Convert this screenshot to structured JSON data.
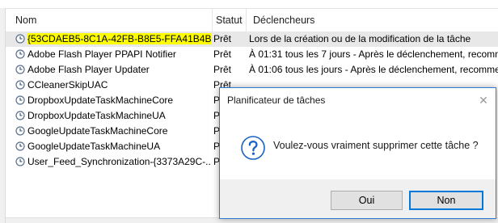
{
  "table": {
    "columns": {
      "name": "Nom",
      "status": "Statut",
      "triggers": "Déclencheurs"
    },
    "rows": [
      {
        "name": "{53CDAEB5-8C1A-42FB-B8E5-FFA41B4B...",
        "status": "Prêt",
        "triggers": "Lors de la création ou de la modification de la tâche",
        "highlighted": true,
        "selected": true
      },
      {
        "name": "Adobe Flash Player PPAPI Notifier",
        "status": "Prêt",
        "triggers": "À 01:31 tous les 7 jours - Après le déclenchement, recomm"
      },
      {
        "name": "Adobe Flash Player Updater",
        "status": "Prêt",
        "triggers": "À 01:06 tous les jours - Après le déclenchement, recommer"
      },
      {
        "name": "CCleanerSkipUAC",
        "status": "Prêt",
        "triggers": ""
      },
      {
        "name": "DropboxUpdateTaskMachineCore",
        "status": "P",
        "triggers": ""
      },
      {
        "name": "DropboxUpdateTaskMachineUA",
        "status": "P",
        "triggers": ""
      },
      {
        "name": "GoogleUpdateTaskMachineCore",
        "status": "P",
        "triggers": ""
      },
      {
        "name": "GoogleUpdateTaskMachineUA",
        "status": "P",
        "triggers": ""
      },
      {
        "name": "User_Feed_Synchronization-{3373A29C-...",
        "status": "P",
        "triggers": ""
      }
    ]
  },
  "dialog": {
    "title": "Planificateur de tâches",
    "close": "✕",
    "icon": "question-icon",
    "message": "Voulez-vous vraiment supprimer cette tâche ?",
    "yes_label": "Oui",
    "no_label": "Non"
  },
  "colors": {
    "highlight": "#ffff00",
    "dialog_border": "#2b7bd3",
    "question_icon": "#1a62c7",
    "default_button_border": "#0078d7"
  }
}
